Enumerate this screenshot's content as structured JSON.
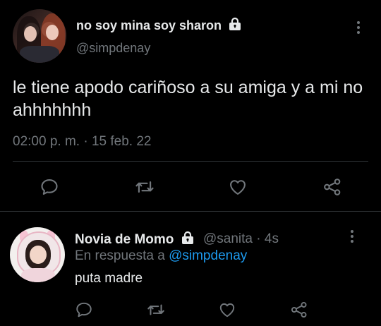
{
  "main_tweet": {
    "author_name": "no soy mina soy sharon",
    "handle": "@simpdenay",
    "text": "le tiene apodo cariñoso a su amiga y a mi no ahhhhhhh",
    "timestamp": "02:00 p. m. · 15 feb. 22",
    "actions": [
      "reply-icon",
      "retweet-icon",
      "like-icon",
      "share-icon"
    ]
  },
  "reply": {
    "author_name": "Novia de Momo",
    "handle_time": "@sanita · 4s",
    "replying_prefix": "En respuesta a",
    "replying_to": "@simpdenay",
    "text": "puta madre",
    "actions": [
      "reply-icon",
      "retweet-icon",
      "like-icon",
      "share-icon"
    ]
  },
  "colors": {
    "background": "#000000",
    "text": "#e7e9ea",
    "muted": "#71767b",
    "link": "#1d9bf0",
    "divider": "#2f3336"
  }
}
